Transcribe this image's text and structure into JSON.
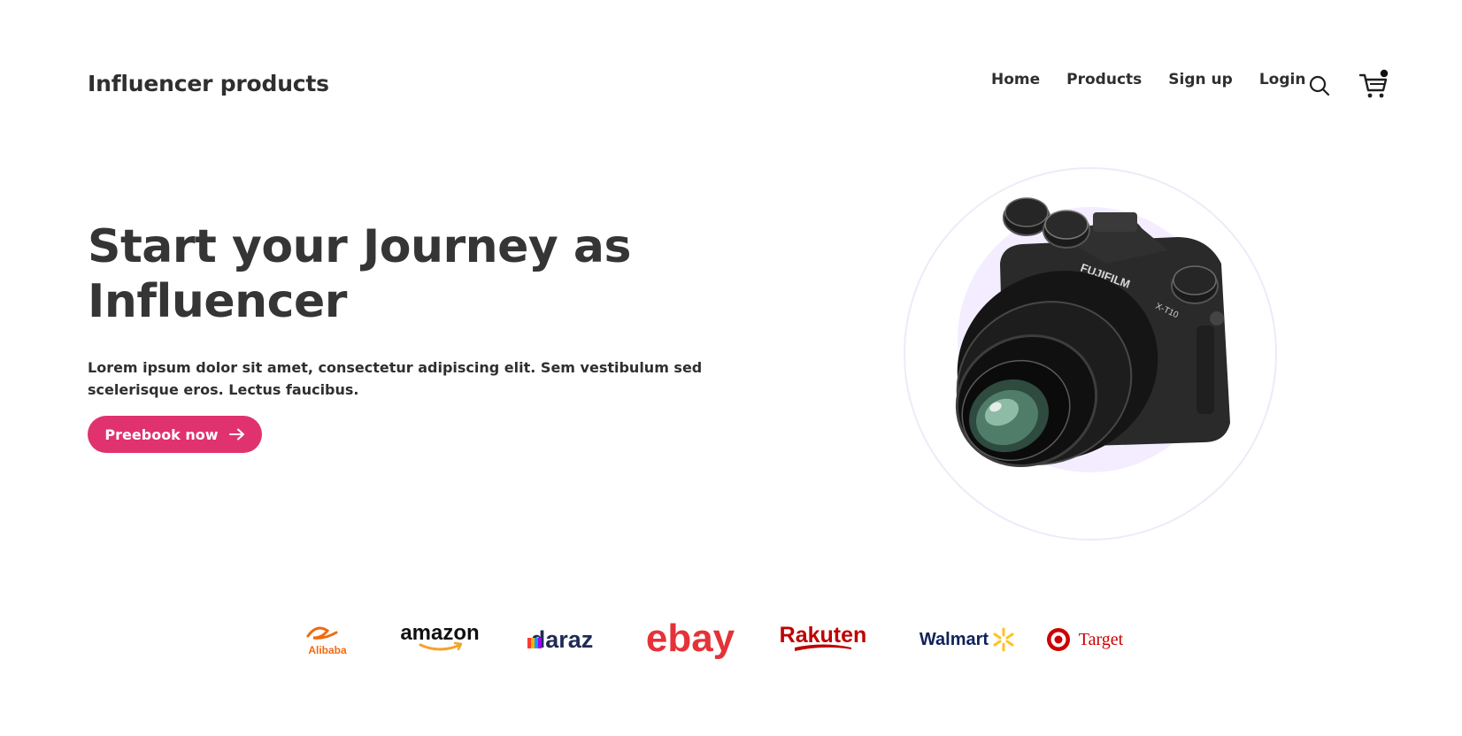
{
  "header": {
    "brand": "Influencer products",
    "nav": [
      "Home",
      "Products",
      "Sign up",
      "Login"
    ]
  },
  "hero": {
    "title_line1": "Start your Journey as",
    "title_line2": "Influencer",
    "description": "Lorem ipsum dolor sit amet, consectetur adipiscing elit. Sem vestibulum sed scelerisque eros. Lectus faucibus.",
    "cta_label": "Preebook now"
  },
  "camera": {
    "brand_text": "FUJIFILM",
    "model_text": "X-T10"
  },
  "brands": [
    "Alibaba",
    "amazon",
    "daraz",
    "ebay",
    "Rakuten",
    "Walmart",
    "Target"
  ],
  "colors": {
    "accent": "#e0326f",
    "text": "#2f2f2f",
    "circle": "#f3edff"
  },
  "icons": {
    "search": "search-icon",
    "cart": "cart-icon",
    "cta_arrow": "arrow-right-icon"
  }
}
